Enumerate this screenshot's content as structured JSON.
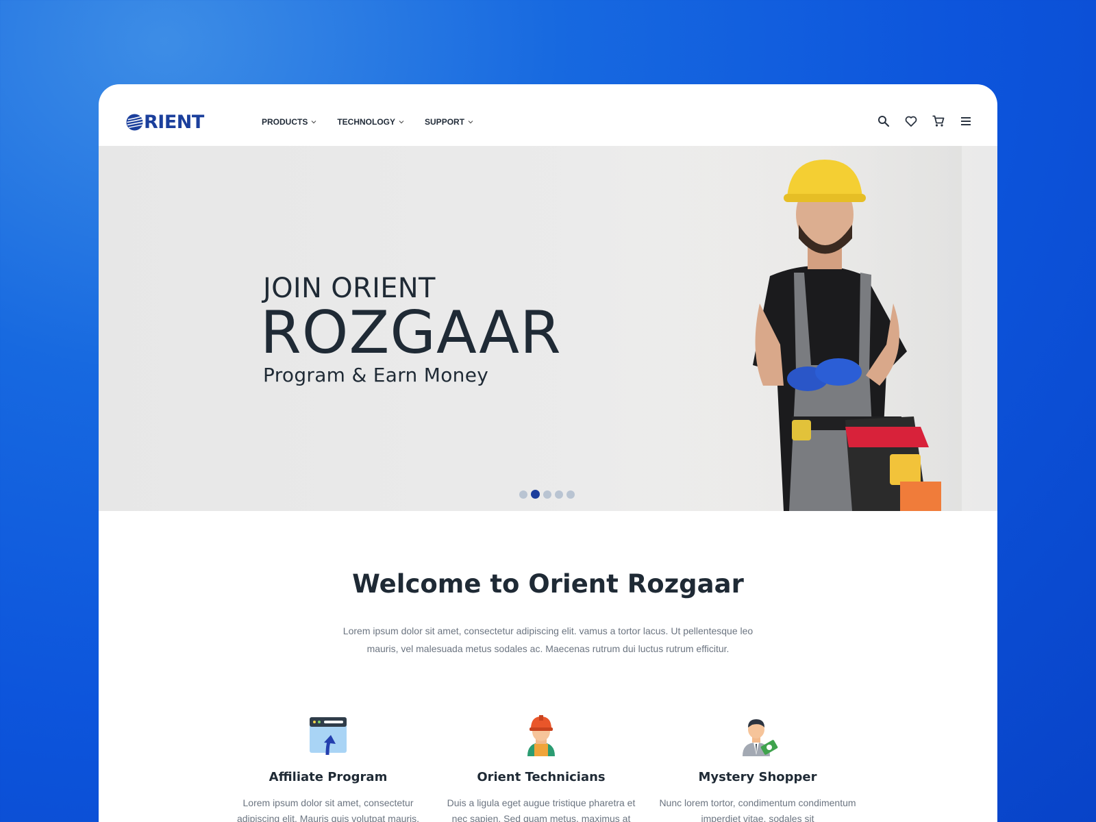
{
  "brand": {
    "logo_text": "RIENT",
    "color": "#1b3f9c"
  },
  "nav": {
    "items": [
      {
        "label": "PRODUCTS"
      },
      {
        "label": "TECHNOLOGY"
      },
      {
        "label": "SUPPORT"
      }
    ]
  },
  "header_icons": [
    "search-icon",
    "heart-icon",
    "cart-icon",
    "menu-icon"
  ],
  "hero": {
    "pre_title": "JOIN ORIENT",
    "title": "ROZGAAR",
    "subtitle": "Program & Earn Money",
    "slide_count": 5,
    "active_slide": 2
  },
  "welcome": {
    "title": "Welcome to Orient Rozgaar",
    "description": "Lorem ipsum dolor sit amet, consectetur adipiscing elit. vamus a tortor lacus. Ut pellentesque leo mauris, vel malesuada metus sodales ac. Maecenas rutrum dui luctus rutrum efficitur."
  },
  "features": [
    {
      "icon": "upload-window-icon",
      "title": "Affiliate Program",
      "description": "Lorem ipsum dolor sit amet, consectetur adipiscing elit. Mauris quis volutpat mauris."
    },
    {
      "icon": "technician-icon",
      "title": "Orient Technicians",
      "description": "Duis a ligula eget augue tristique pharetra et nec sapien. Sed quam metus, maximus at"
    },
    {
      "icon": "shopper-icon",
      "title": "Mystery Shopper",
      "description": "Nunc lorem tortor, condimentum condimentum imperdiet vitae, sodales sit"
    }
  ],
  "colors": {
    "accent": "#1c3d9c",
    "text": "#1f2a35",
    "muted": "#6b7480",
    "background": "#0d55dc"
  }
}
